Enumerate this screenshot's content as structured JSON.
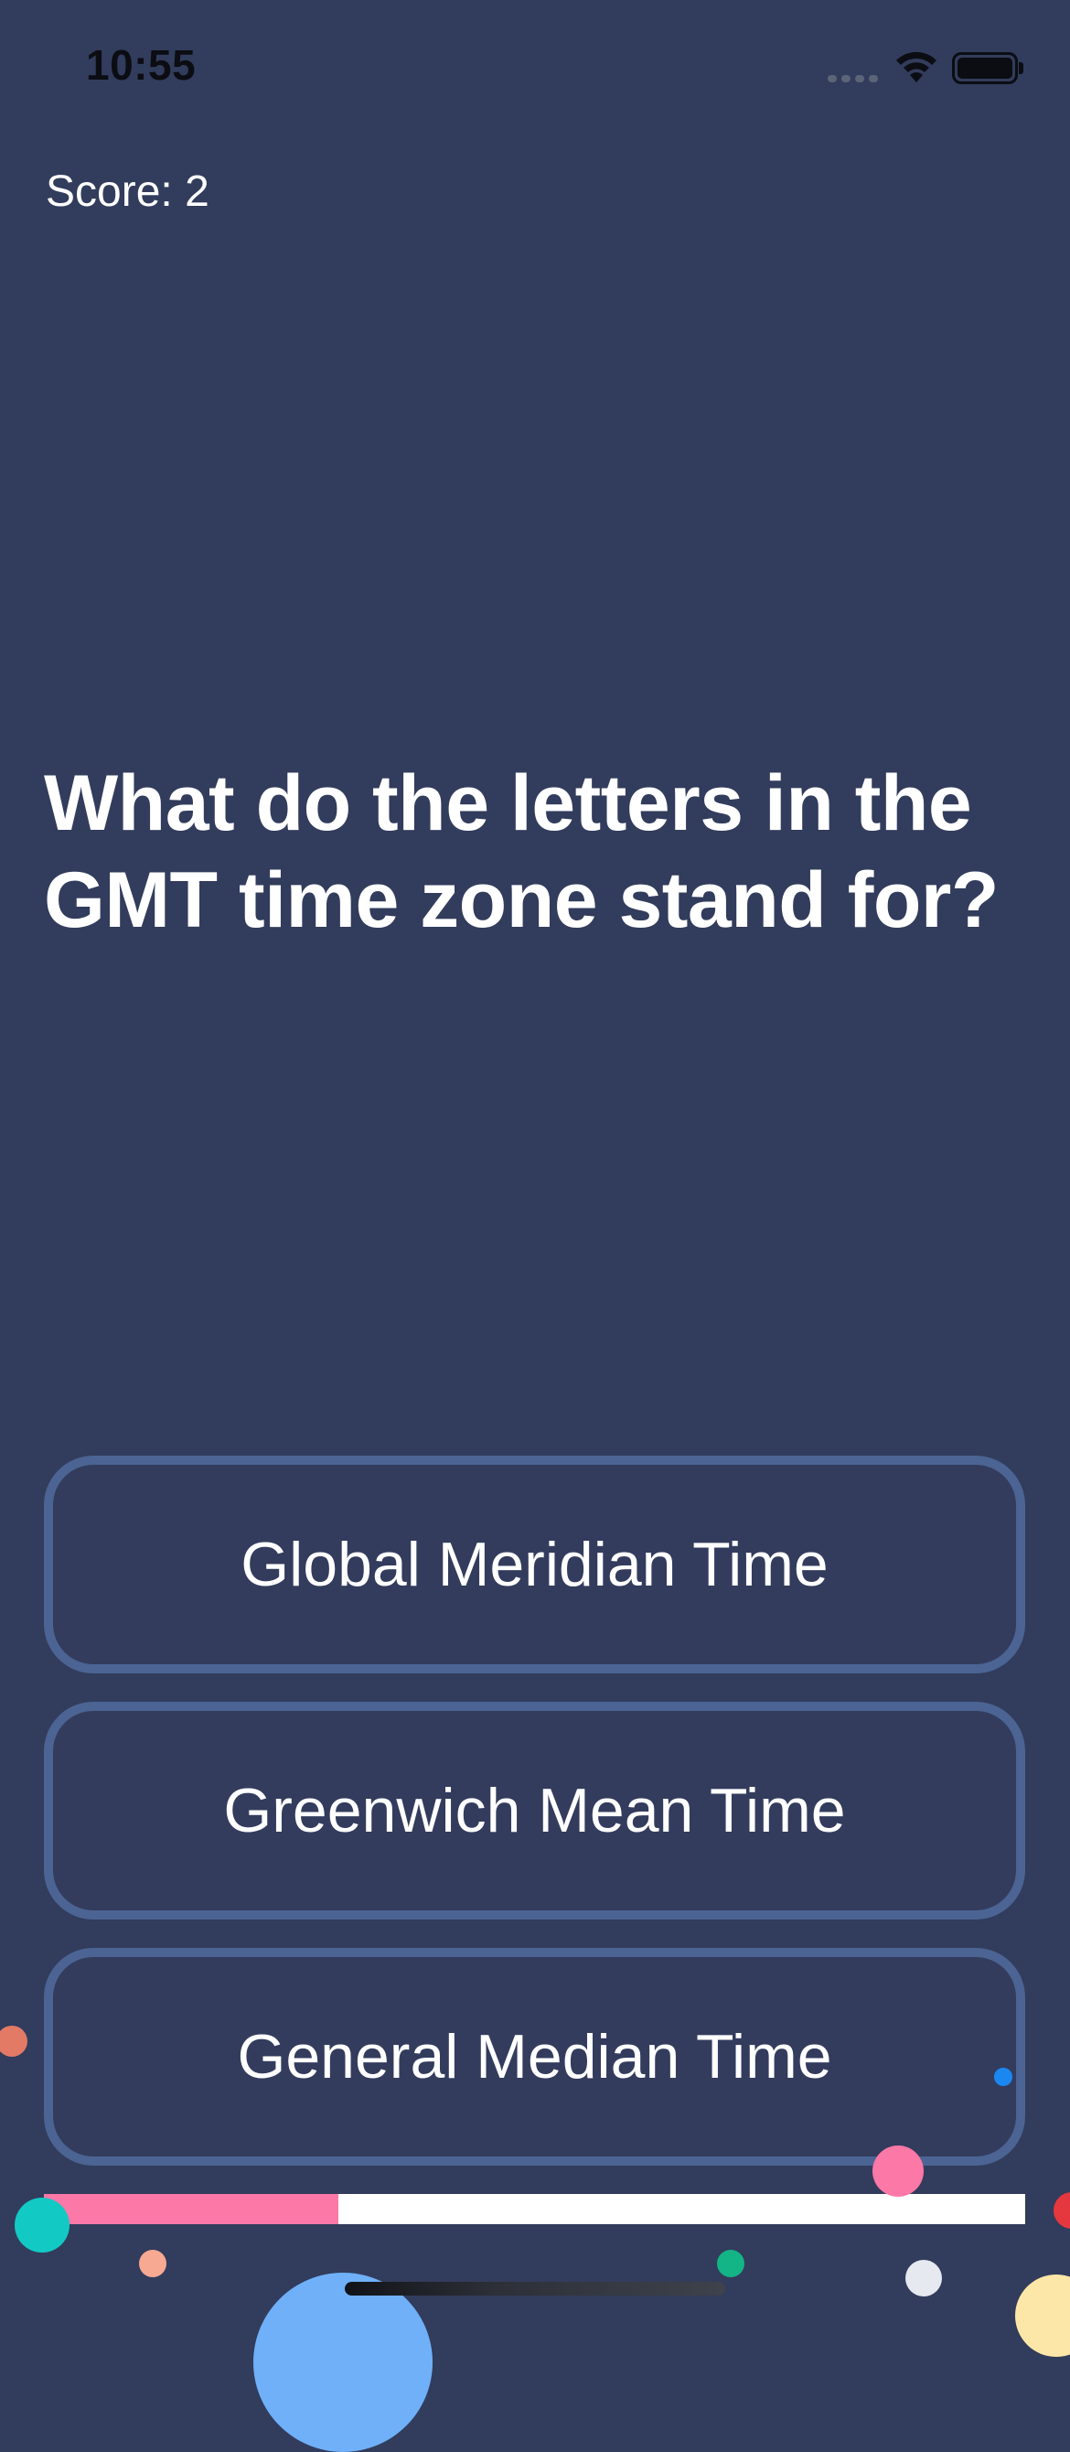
{
  "status_bar": {
    "time": "10:55",
    "icons": [
      "cellular-signal-icon",
      "wifi-icon",
      "battery-icon"
    ]
  },
  "quiz": {
    "score_text": "Score: 2",
    "question_line_1": "What do the letters in the",
    "question_line_2": "GMT time zone stand for?",
    "answers": [
      {
        "label": "Global Meridian Time"
      },
      {
        "label": "Greenwich Mean Time"
      },
      {
        "label": "General Median Time"
      }
    ],
    "timer_progress": 0.3
  },
  "colors": {
    "background": "#323c5c",
    "answer_border": "#4b6493",
    "progress_fill": "#fb78a7",
    "progress_track": "#ffffff"
  }
}
